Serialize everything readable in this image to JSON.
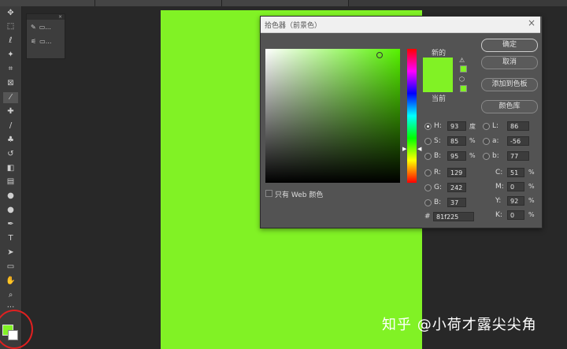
{
  "colors": {
    "selected": "#81f225",
    "canvas": "#81f225",
    "annotation": "#e02020"
  },
  "toolbar": {
    "tools": [
      "move-icon",
      "marquee-icon",
      "lasso-icon",
      "magic-wand-icon",
      "crop-icon",
      "frame-icon",
      "eyedropper-icon",
      "healing-icon",
      "brush-icon",
      "stamp-icon",
      "history-brush-icon",
      "eraser-icon",
      "gradient-icon",
      "blur-icon",
      "dodge-icon",
      "pen-icon",
      "type-icon",
      "path-select-icon",
      "shape-icon",
      "hand-icon",
      "zoom-icon",
      "more-icon"
    ]
  },
  "mini_panel": {
    "rows": [
      "▭...",
      "▭..."
    ]
  },
  "dialog": {
    "title": "拾色器（前景色）",
    "new_label": "新的",
    "current_label": "当前",
    "buttons": {
      "ok": "确定",
      "cancel": "取消",
      "add_swatch": "添加到色板",
      "libraries": "颜色库"
    },
    "hsb": {
      "h": "93",
      "h_unit": "度",
      "s": "85",
      "s_unit": "%",
      "b": "95",
      "b_unit": "%"
    },
    "rgb": {
      "r": "129",
      "g": "242",
      "b": "37"
    },
    "lab": {
      "l": "86",
      "a": "-56",
      "b": "77"
    },
    "cmyk": {
      "c": "51",
      "m": "0",
      "y": "92",
      "k": "0",
      "unit": "%"
    },
    "hex": "81f225",
    "web_only": "只有 Web 颜色",
    "labels": {
      "H": "H:",
      "S": "S:",
      "B": "B:",
      "R": "R:",
      "G": "G:",
      "Bl": "B:",
      "L": "L:",
      "a": "a:",
      "b": "b:",
      "C": "C:",
      "M": "M:",
      "Y": "Y:",
      "K": "K:",
      "hash": "#"
    }
  },
  "watermark": "知乎 @小荷才露尖尖角"
}
